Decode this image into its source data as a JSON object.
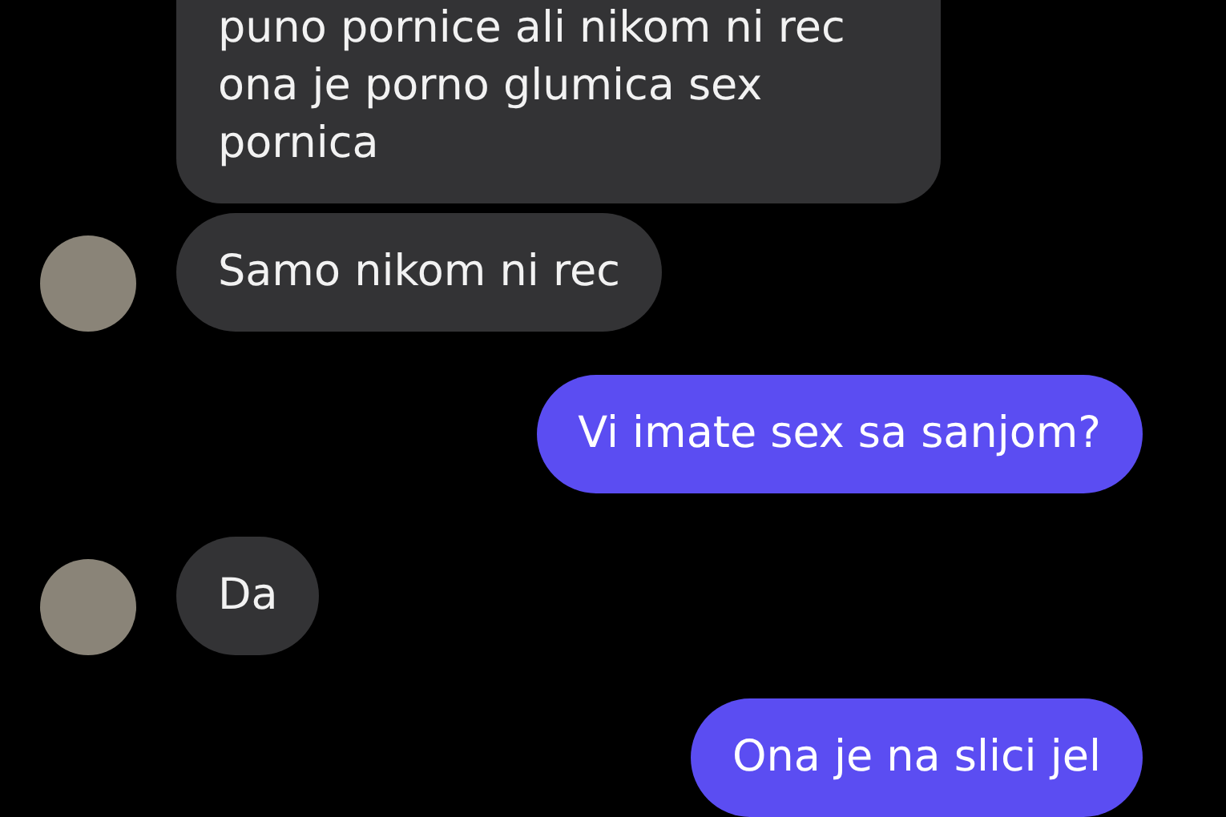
{
  "messages": [
    {
      "kind": "incoming",
      "avatar": false,
      "lines": [
        "puno pornice ali nikom ni rec",
        "ona je porno glumica sex",
        "pornica"
      ]
    },
    {
      "kind": "incoming",
      "avatar": true,
      "lines": [
        "Samo nikom ni rec"
      ]
    },
    {
      "kind": "outgoing",
      "lines": [
        "Vi imate sex sa sanjom?"
      ]
    },
    {
      "kind": "incoming",
      "avatar": true,
      "lines": [
        "Da"
      ]
    },
    {
      "kind": "outgoing",
      "lines": [
        "Ona je na slici jel"
      ]
    }
  ]
}
